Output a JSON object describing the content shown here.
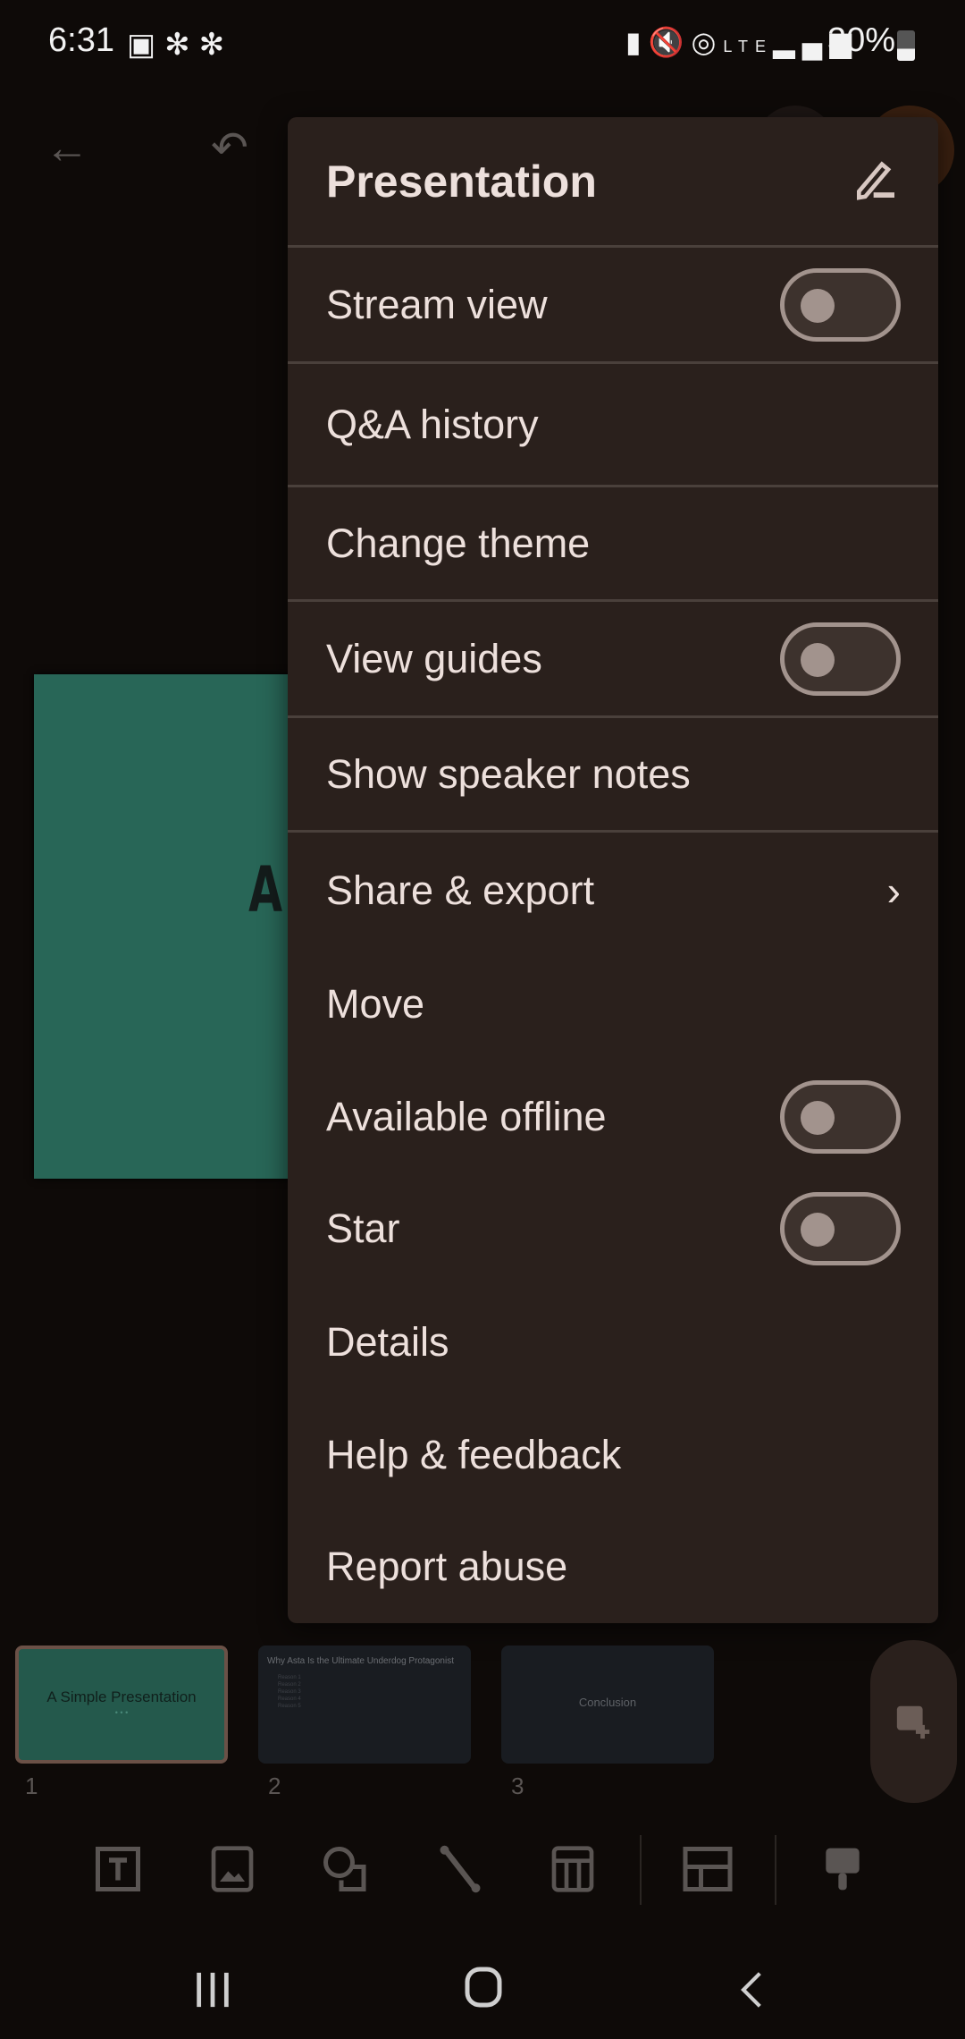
{
  "status_bar": {
    "time": "6:31",
    "battery": "30%",
    "network": "LTE",
    "left_icons": [
      "image-icon",
      "slack-icon",
      "slack-icon"
    ],
    "right_icons": [
      "battery-saver-icon",
      "mute-icon",
      "hotspot-icon",
      "lte-icon",
      "signal-icon"
    ]
  },
  "menu": {
    "title": "Presentation",
    "items": [
      {
        "label": "Stream view",
        "toggle": false
      },
      {
        "label": "Q&A history"
      },
      {
        "label": "Change theme"
      },
      {
        "label": "View guides",
        "toggle": false
      },
      {
        "label": "Show speaker notes"
      },
      {
        "label": "Share & export",
        "submenu": true
      },
      {
        "label": "Move"
      },
      {
        "label": "Available offline",
        "toggle": false
      },
      {
        "label": "Star",
        "toggle": false
      },
      {
        "label": "Details"
      },
      {
        "label": "Help & feedback"
      },
      {
        "label": "Report abuse"
      }
    ]
  },
  "canvas": {
    "slide_text": "A",
    "slide_color": "#286657"
  },
  "thumbnails": [
    {
      "number": "1",
      "title": "A Simple Presentation",
      "subtitle": "• • •",
      "selected": true
    },
    {
      "number": "2",
      "title": "Why Asta Is the Ultimate Underdog Protagonist",
      "bullets": [
        "Reason 1",
        "Reason 2",
        "Reason 3",
        "Reason 4",
        "Reason 5"
      ]
    },
    {
      "number": "3",
      "title": "Conclusion"
    }
  ],
  "colors": {
    "menu_bg": "#2a201c",
    "text": "#ede0dc",
    "toggle": "#a2938d",
    "accent_avatar": "#3a2010"
  }
}
